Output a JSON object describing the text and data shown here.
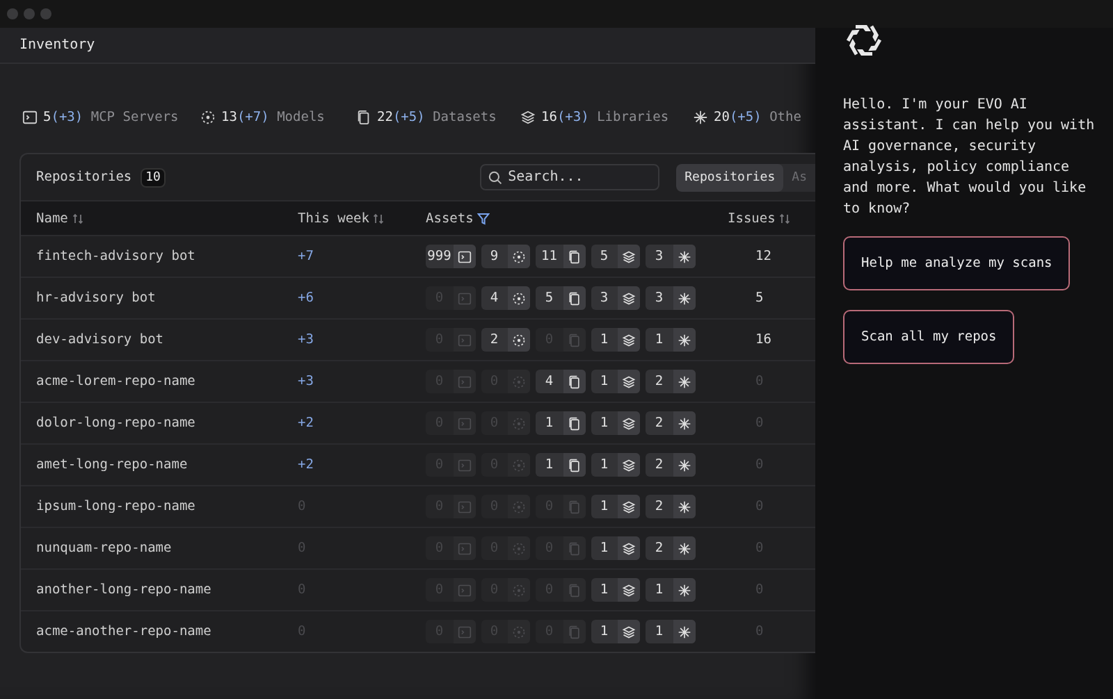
{
  "page": {
    "title": "Inventory"
  },
  "stats": [
    {
      "kind": "mcp",
      "count": "5",
      "delta": "(+3)",
      "label": "MCP Servers"
    },
    {
      "kind": "model",
      "count": "13",
      "delta": "(+7)",
      "label": "Models"
    },
    {
      "kind": "dataset",
      "count": "22",
      "delta": "(+5)",
      "label": "Datasets"
    },
    {
      "kind": "library",
      "count": "16",
      "delta": "(+3)",
      "label": "Libraries"
    },
    {
      "kind": "other",
      "count": "20",
      "delta": "(+5)",
      "label": "Othe"
    }
  ],
  "card": {
    "title": "Repositories",
    "count": "10",
    "search": {
      "placeholder": "Search..."
    },
    "tabs": [
      {
        "label": "Repositories",
        "selected": true
      },
      {
        "label": "As",
        "selected": false
      }
    ]
  },
  "table": {
    "columns": [
      {
        "label": "Name",
        "kind": "sortable"
      },
      {
        "label": "This week",
        "kind": "sortable"
      },
      {
        "label": "Assets",
        "kind": "filterable"
      },
      {
        "label": "Issues",
        "kind": "sortable"
      }
    ],
    "rows": [
      {
        "name": "fintech-advisory bot",
        "week": {
          "text": "+7",
          "muted": false
        },
        "assets": [
          {
            "kind": "mcp",
            "count": "999",
            "muted": false
          },
          {
            "kind": "model",
            "count": "9",
            "muted": false
          },
          {
            "kind": "dataset",
            "count": "11",
            "muted": false
          },
          {
            "kind": "library",
            "count": "5",
            "muted": false
          },
          {
            "kind": "other",
            "count": "3",
            "muted": false
          }
        ],
        "issues": {
          "text": "12",
          "muted": false
        }
      },
      {
        "name": "hr-advisory bot",
        "week": {
          "text": "+6",
          "muted": false
        },
        "assets": [
          {
            "kind": "mcp",
            "count": "0",
            "muted": true
          },
          {
            "kind": "model",
            "count": "4",
            "muted": false
          },
          {
            "kind": "dataset",
            "count": "5",
            "muted": false
          },
          {
            "kind": "library",
            "count": "3",
            "muted": false
          },
          {
            "kind": "other",
            "count": "3",
            "muted": false
          }
        ],
        "issues": {
          "text": "5",
          "muted": false
        }
      },
      {
        "name": "dev-advisory bot",
        "week": {
          "text": "+3",
          "muted": false
        },
        "assets": [
          {
            "kind": "mcp",
            "count": "0",
            "muted": true
          },
          {
            "kind": "model",
            "count": "2",
            "muted": false
          },
          {
            "kind": "dataset",
            "count": "0",
            "muted": true
          },
          {
            "kind": "library",
            "count": "1",
            "muted": false
          },
          {
            "kind": "other",
            "count": "1",
            "muted": false
          }
        ],
        "issues": {
          "text": "16",
          "muted": false
        }
      },
      {
        "name": "acme-lorem-repo-name",
        "week": {
          "text": "+3",
          "muted": false
        },
        "assets": [
          {
            "kind": "mcp",
            "count": "0",
            "muted": true
          },
          {
            "kind": "model",
            "count": "0",
            "muted": true
          },
          {
            "kind": "dataset",
            "count": "4",
            "muted": false
          },
          {
            "kind": "library",
            "count": "1",
            "muted": false
          },
          {
            "kind": "other",
            "count": "2",
            "muted": false
          }
        ],
        "issues": {
          "text": "0",
          "muted": true
        }
      },
      {
        "name": "dolor-long-repo-name",
        "week": {
          "text": "+2",
          "muted": false
        },
        "assets": [
          {
            "kind": "mcp",
            "count": "0",
            "muted": true
          },
          {
            "kind": "model",
            "count": "0",
            "muted": true
          },
          {
            "kind": "dataset",
            "count": "1",
            "muted": false
          },
          {
            "kind": "library",
            "count": "1",
            "muted": false
          },
          {
            "kind": "other",
            "count": "2",
            "muted": false
          }
        ],
        "issues": {
          "text": "0",
          "muted": true
        }
      },
      {
        "name": "amet-long-repo-name",
        "week": {
          "text": "+2",
          "muted": false
        },
        "assets": [
          {
            "kind": "mcp",
            "count": "0",
            "muted": true
          },
          {
            "kind": "model",
            "count": "0",
            "muted": true
          },
          {
            "kind": "dataset",
            "count": "1",
            "muted": false
          },
          {
            "kind": "library",
            "count": "1",
            "muted": false
          },
          {
            "kind": "other",
            "count": "2",
            "muted": false
          }
        ],
        "issues": {
          "text": "0",
          "muted": true
        }
      },
      {
        "name": "ipsum-long-repo-name",
        "week": {
          "text": "0",
          "muted": true
        },
        "assets": [
          {
            "kind": "mcp",
            "count": "0",
            "muted": true
          },
          {
            "kind": "model",
            "count": "0",
            "muted": true
          },
          {
            "kind": "dataset",
            "count": "0",
            "muted": true
          },
          {
            "kind": "library",
            "count": "1",
            "muted": false
          },
          {
            "kind": "other",
            "count": "2",
            "muted": false
          }
        ],
        "issues": {
          "text": "0",
          "muted": true
        }
      },
      {
        "name": "nunquam-repo-name",
        "week": {
          "text": "0",
          "muted": true
        },
        "assets": [
          {
            "kind": "mcp",
            "count": "0",
            "muted": true
          },
          {
            "kind": "model",
            "count": "0",
            "muted": true
          },
          {
            "kind": "dataset",
            "count": "0",
            "muted": true
          },
          {
            "kind": "library",
            "count": "1",
            "muted": false
          },
          {
            "kind": "other",
            "count": "2",
            "muted": false
          }
        ],
        "issues": {
          "text": "0",
          "muted": true
        }
      },
      {
        "name": "another-long-repo-name",
        "week": {
          "text": "0",
          "muted": true
        },
        "assets": [
          {
            "kind": "mcp",
            "count": "0",
            "muted": true
          },
          {
            "kind": "model",
            "count": "0",
            "muted": true
          },
          {
            "kind": "dataset",
            "count": "0",
            "muted": true
          },
          {
            "kind": "library",
            "count": "1",
            "muted": false
          },
          {
            "kind": "other",
            "count": "1",
            "muted": false
          }
        ],
        "issues": {
          "text": "0",
          "muted": true
        }
      },
      {
        "name": "acme-another-repo-name",
        "week": {
          "text": "0",
          "muted": true
        },
        "assets": [
          {
            "kind": "mcp",
            "count": "0",
            "muted": true
          },
          {
            "kind": "model",
            "count": "0",
            "muted": true
          },
          {
            "kind": "dataset",
            "count": "0",
            "muted": true
          },
          {
            "kind": "library",
            "count": "1",
            "muted": false
          },
          {
            "kind": "other",
            "count": "1",
            "muted": false
          }
        ],
        "issues": {
          "text": "0",
          "muted": true
        }
      }
    ]
  },
  "assistant": {
    "message": "Hello. I'm your EVO AI assistant. I can help you with AI governance, security analysis, policy compliance and more. What would you like to know?",
    "suggestions": [
      "Help me analyze my scans",
      "Scan all my repos"
    ]
  }
}
